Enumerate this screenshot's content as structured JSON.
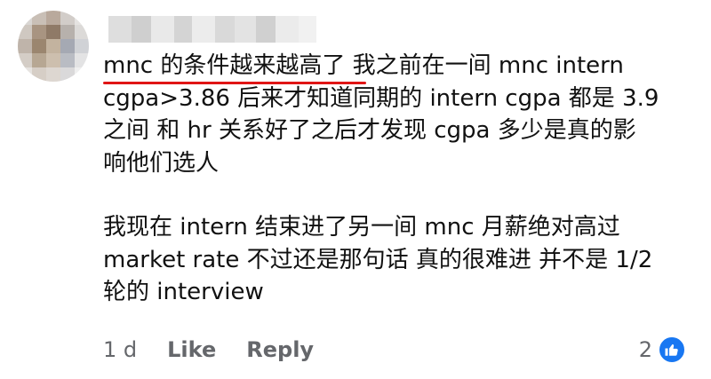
{
  "comment": {
    "line1": "mnc 的条件越来越高了  我之前在一间 mnc intern",
    "line2": "cgpa>3.86 后来才知道同期的 intern cgpa 都是 3.9",
    "line3": "之间 和 hr 关系好了之后才发现 cgpa 多少是真的影",
    "line4": "响他们选人",
    "line5": "我现在 intern 结束进了另一间 mnc  月薪绝对高过",
    "line6": "market rate 不过还是那句话 真的很难进  并不是 1/2",
    "line7": "轮的 interview"
  },
  "actions": {
    "time": "1 d",
    "like": "Like",
    "reply": "Reply"
  },
  "reactions": {
    "count": "2",
    "icon": "thumbs-up-icon"
  },
  "colors": {
    "underline": "#e01515",
    "reaction_badge": "#1877f2",
    "meta_text": "#65676b"
  }
}
